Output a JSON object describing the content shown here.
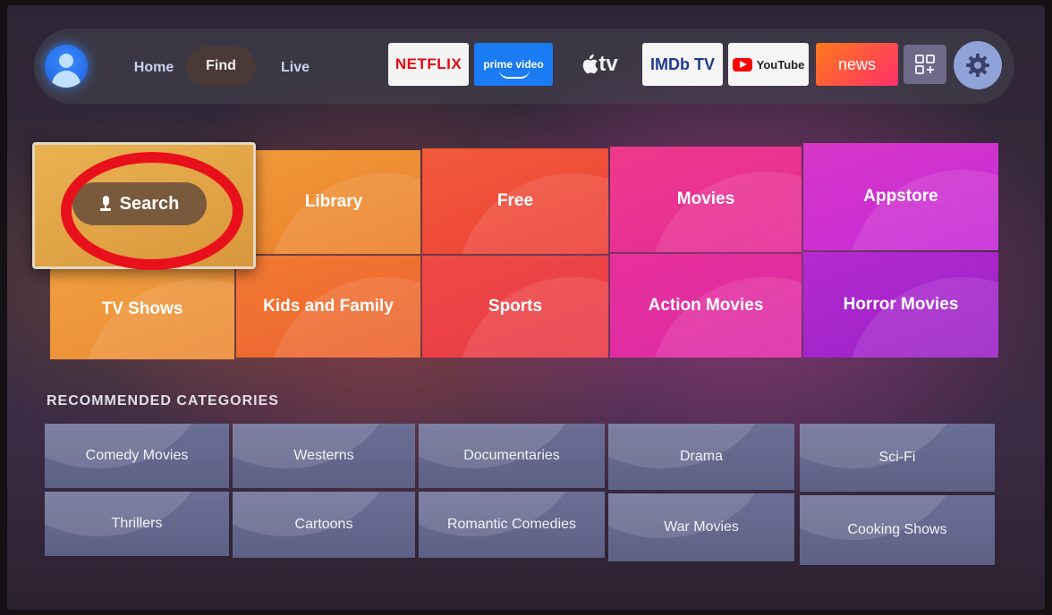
{
  "nav": {
    "tabs": [
      {
        "label": "Home"
      },
      {
        "label": "Find",
        "active": true
      },
      {
        "label": "Live"
      }
    ],
    "apps": {
      "netflix": "NETFLIX",
      "prime": "prime video",
      "appletv": "tv",
      "imdb": "IMDb TV",
      "youtube": "YouTube",
      "news": "news"
    },
    "icons": [
      "profile-icon",
      "all-apps-icon",
      "settings-gear-icon"
    ]
  },
  "find": {
    "search_label": "Search",
    "tiles": [
      "Library",
      "Free",
      "Movies",
      "Appstore",
      "TV Shows",
      "Kids and Family",
      "Sports",
      "Action Movies",
      "Horror Movies"
    ]
  },
  "recommended": {
    "heading": "RECOMMENDED CATEGORIES",
    "items": [
      "Comedy Movies",
      "Westerns",
      "Documentaries",
      "Drama",
      "Sci-Fi",
      "Thrillers",
      "Cartoons",
      "Romantic Comedies",
      "War Movies",
      "Cooking Shows"
    ]
  },
  "colors": {
    "annotation": "#e8111b",
    "netflix": "#e50914",
    "prime": "#1a7bf2"
  }
}
